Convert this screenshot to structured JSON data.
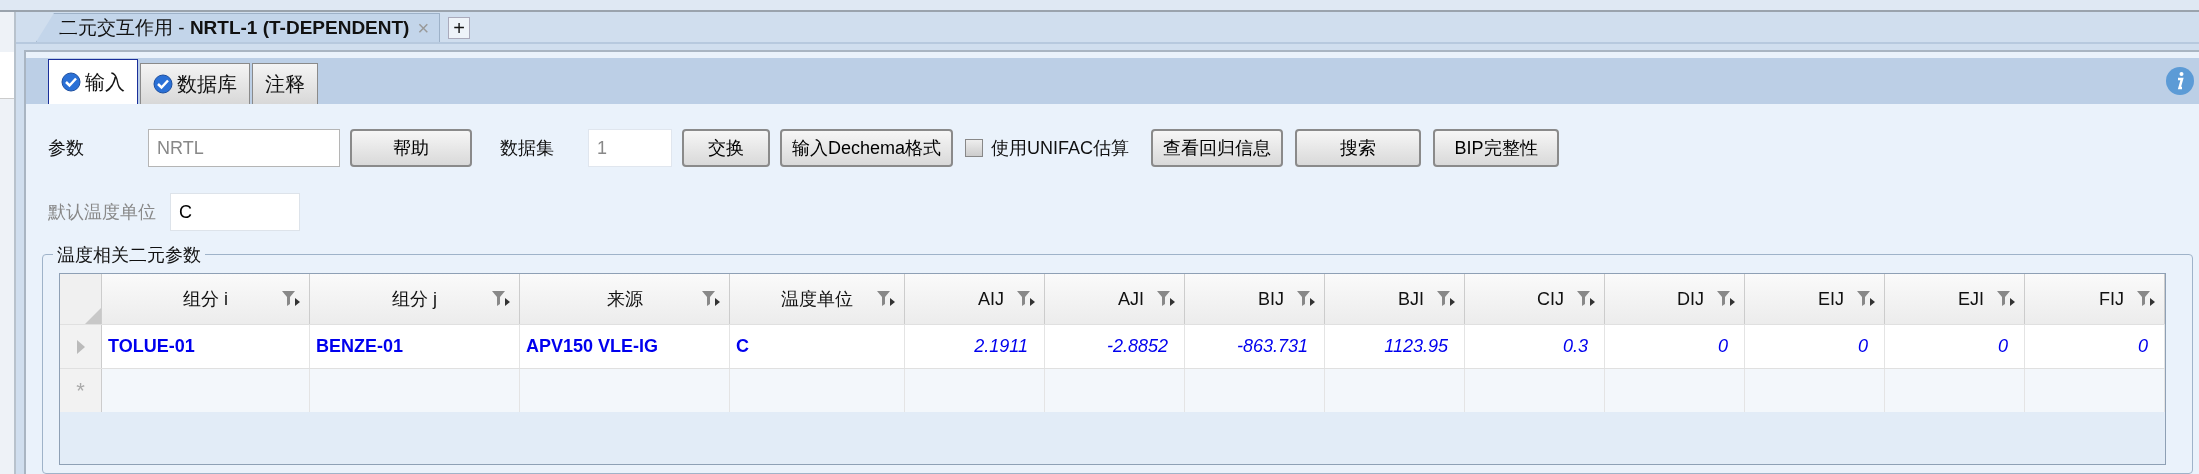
{
  "document_tab": {
    "title": "二元交互作用 - **NRTL-1 (T-DEPENDENT)**",
    "close": "×",
    "add": "+"
  },
  "tabs": [
    {
      "label": "输入",
      "kind": "checked",
      "selected": true
    },
    {
      "label": "数据库",
      "kind": "checked",
      "selected": false
    },
    {
      "label": "注释",
      "kind": "plain",
      "selected": false
    }
  ],
  "form": {
    "parameter_label": "参数",
    "parameter_value": "NRTL",
    "help_button": "帮助",
    "dataset_label": "数据集",
    "dataset_value": "1",
    "buttons": [
      "交换",
      "输入Dechema格式"
    ],
    "unifac": {
      "label": "使用UNIFAC估算",
      "checked": false
    },
    "buttons_after": [
      "查看回归信息",
      "搜索",
      "BIP完整性"
    ],
    "temp_unit_label": "默认温度单位",
    "temp_unit_disabled": true,
    "temp_unit_value": "C"
  },
  "group": {
    "title": "温度相关二元参数",
    "table": {
      "columns": [
        {
          "label": "组分 i",
          "kind": "text"
        },
        {
          "label": "组分 j",
          "kind": "text"
        },
        {
          "label": "来源",
          "kind": "text"
        },
        {
          "label": "温度单位",
          "kind": "text"
        },
        {
          "label": "AIJ",
          "kind": "number"
        },
        {
          "label": "AJI",
          "kind": "number"
        },
        {
          "label": "BIJ",
          "kind": "number"
        },
        {
          "label": "BJI",
          "kind": "number"
        },
        {
          "label": "CIJ",
          "kind": "number"
        },
        {
          "label": "DIJ",
          "kind": "number"
        },
        {
          "label": "EIJ",
          "kind": "number"
        },
        {
          "label": "EJI",
          "kind": "number"
        },
        {
          "label": "FIJ",
          "kind": "number"
        }
      ],
      "rows": [
        {
          "cells": [
            "TOLUE-01",
            "BENZE-01",
            "APV150 VLE-IG",
            "C",
            "2.1911",
            "-2.8852",
            "-863.731",
            "1123.95",
            "0.3",
            "0",
            "0",
            "0",
            "0"
          ]
        }
      ],
      "new_row_marker": "*"
    }
  }
}
